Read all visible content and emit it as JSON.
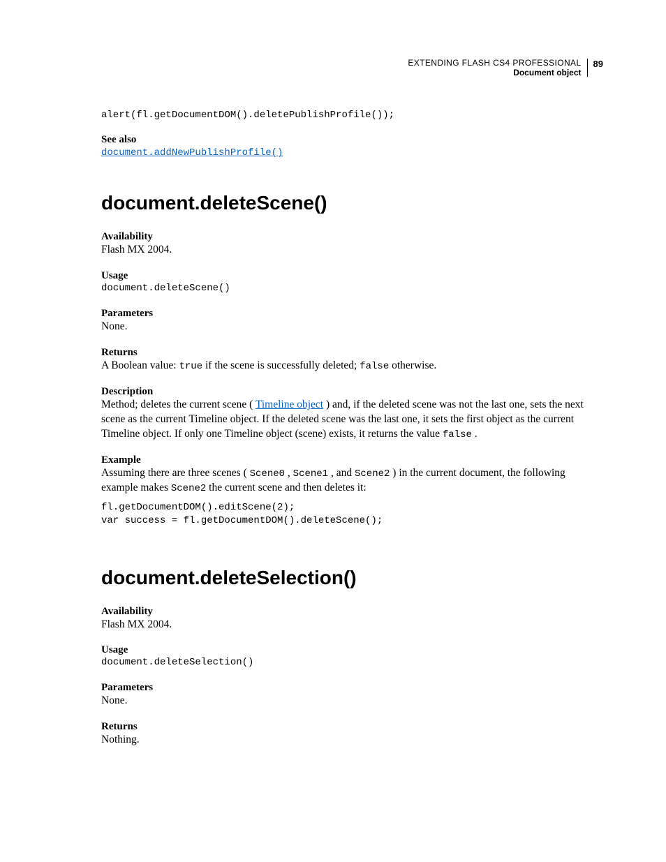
{
  "header": {
    "book_title": "EXTENDING FLASH CS4 PROFESSIONAL",
    "section": "Document object",
    "page_number": "89"
  },
  "top_code": "alert(fl.getDocumentDOM().deletePublishProfile());",
  "see_also": {
    "label": "See also",
    "link_text": "document.addNewPublishProfile()"
  },
  "method1": {
    "heading": "document.deleteScene()",
    "availability": {
      "label": "Availability",
      "text": "Flash MX 2004."
    },
    "usage": {
      "label": "Usage",
      "code": "document.deleteScene()"
    },
    "parameters": {
      "label": "Parameters",
      "text": "None."
    },
    "returns": {
      "label": "Returns",
      "pre": "A Boolean value: ",
      "code1": "true",
      "mid": " if the scene is successfully deleted; ",
      "code2": "false",
      "post": " otherwise."
    },
    "description": {
      "label": "Description",
      "pre": "Method; deletes the current scene (",
      "link": "Timeline object",
      "mid": ") and, if the deleted scene was not the last one, sets the next scene as the current Timeline object. If the deleted scene was the last one, it sets the first object as the current Timeline object. If only one Timeline object (scene) exists, it returns the value ",
      "code1": "false",
      "post": "."
    },
    "example": {
      "label": "Example",
      "pre": "Assuming there are three scenes (",
      "c1": "Scene0",
      "s1": ", ",
      "c2": "Scene1",
      "s2": ", and ",
      "c3": "Scene2",
      "mid": ") in the current document, the following example makes ",
      "c4": "Scene2",
      "post": " the current scene and then deletes it:",
      "code": "fl.getDocumentDOM().editScene(2);\nvar success = fl.getDocumentDOM().deleteScene();"
    }
  },
  "method2": {
    "heading": "document.deleteSelection()",
    "availability": {
      "label": "Availability",
      "text": "Flash MX 2004."
    },
    "usage": {
      "label": "Usage",
      "code": "document.deleteSelection()"
    },
    "parameters": {
      "label": "Parameters",
      "text": "None."
    },
    "returns": {
      "label": "Returns",
      "text": "Nothing."
    }
  }
}
